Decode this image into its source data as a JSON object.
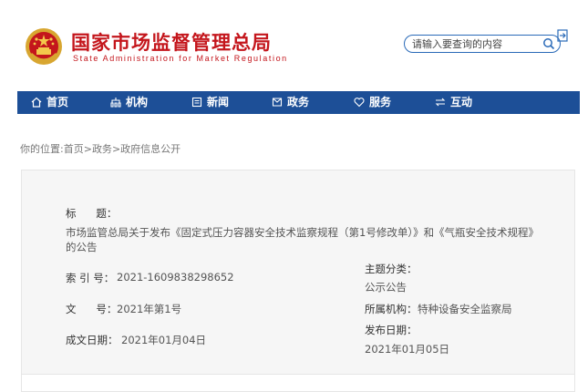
{
  "header": {
    "site_title": "国家市场监督管理总局",
    "site_subtitle": "State Administration for Market Regulation",
    "search_placeholder": "请输入要查询的内容",
    "brand_color": "#c4161c"
  },
  "nav": {
    "bg_color": "#1d4f97",
    "items": [
      {
        "label": "首页",
        "icon": "home-icon"
      },
      {
        "label": "机构",
        "icon": "organization-icon"
      },
      {
        "label": "新闻",
        "icon": "news-icon"
      },
      {
        "label": "政务",
        "icon": "government-affairs-icon"
      },
      {
        "label": "服务",
        "icon": "heart-icon"
      },
      {
        "label": "互动",
        "icon": "exchange-icon"
      }
    ]
  },
  "breadcrumb": {
    "prefix": "你的位置:",
    "items": [
      "首页",
      "政务",
      "政府信息公开"
    ],
    "separator": ">"
  },
  "document": {
    "title_label": "标      题：",
    "title_value": "市场监管总局关于发布《固定式压力容器安全技术监察规程（第1号修改单）》和《气瓶安全技术规程》的公告",
    "index_label": "索 引 号：",
    "index_value": "2021-1609838298652",
    "category_label": "主题分类：",
    "category_value": "公示公告",
    "doc_no_label": "文      号：",
    "doc_no_value": "2021年第1号",
    "agency_label": "所属机构：",
    "agency_value": "特种设备安全监察局",
    "written_date_label": "成文日期：",
    "written_date_value": "2021年01月04日",
    "publish_date_label": "发布日期：",
    "publish_date_value": "2021年01月05日"
  }
}
